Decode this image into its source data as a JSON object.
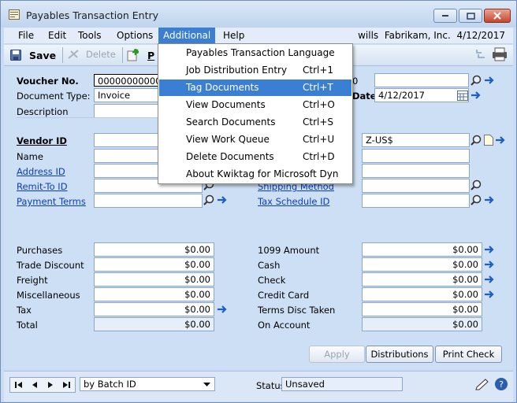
{
  "window": {
    "title": "Payables Transaction Entry"
  },
  "menubar": {
    "items": [
      "File",
      "Edit",
      "Tools",
      "Options",
      "Additional",
      "Help"
    ],
    "user": "wills",
    "company": "Fabrikam, Inc.",
    "date": "4/12/2017"
  },
  "toolbar": {
    "save": "Save",
    "delete": "Delete",
    "post_partial": "P"
  },
  "dropdown": {
    "items": [
      {
        "label": "Payables Transaction Language",
        "shortcut": ""
      },
      {
        "label": "Job Distribution Entry",
        "shortcut": "Ctrl+1"
      },
      {
        "label": "Tag Documents",
        "shortcut": "Ctrl+T"
      },
      {
        "label": "View Documents",
        "shortcut": "Ctrl+O"
      },
      {
        "label": "Search Documents",
        "shortcut": "Ctrl+S"
      },
      {
        "label": "View Work Queue",
        "shortcut": "Ctrl+U"
      },
      {
        "label": "Delete Documents",
        "shortcut": "Ctrl+D"
      },
      {
        "label": "About Kwiktag for Microsoft Dyn",
        "shortcut": ""
      }
    ]
  },
  "form": {
    "voucher_label": "Voucher No.",
    "voucher_value": "00000000000000",
    "doctype_label": "Document Type:",
    "doctype_value": "Invoice",
    "description_label": "Description",
    "vendor_label": "Vendor ID",
    "name_label": "Name",
    "address_label": "Address ID",
    "remit_label": "Remit-To ID",
    "terms_label": "Payment Terms",
    "right_top_partial": "0",
    "date_label_partial": "Date",
    "date_value": "4/12/2017",
    "currency_value": "Z-US$",
    "shipping_label": "Shipping Method",
    "tax_schedule_label": "Tax Schedule ID"
  },
  "amounts_left": [
    {
      "label": "Purchases",
      "value": "$0.00"
    },
    {
      "label": "Trade Discount",
      "value": "$0.00"
    },
    {
      "label": "Freight",
      "value": "$0.00"
    },
    {
      "label": "Miscellaneous",
      "value": "$0.00"
    },
    {
      "label": "Tax",
      "value": "$0.00"
    },
    {
      "label": "Total",
      "value": "$0.00"
    }
  ],
  "amounts_right": [
    {
      "label": "1099 Amount",
      "value": "$0.00"
    },
    {
      "label": "Cash",
      "value": "$0.00"
    },
    {
      "label": "Check",
      "value": "$0.00"
    },
    {
      "label": "Credit Card",
      "value": "$0.00"
    },
    {
      "label": "Terms Disc Taken",
      "value": "$0.00"
    },
    {
      "label": "On Account",
      "value": "$0.00"
    }
  ],
  "buttons": {
    "apply": "Apply",
    "distributions": "Distributions",
    "print_check": "Print Check"
  },
  "bottom": {
    "browse_by": "by Batch ID",
    "status_label": "Status",
    "status_value": "Unsaved"
  },
  "colors": {
    "accent": "#3b7fd4",
    "link": "#0b3fb6",
    "panel": "#ccdff4"
  }
}
